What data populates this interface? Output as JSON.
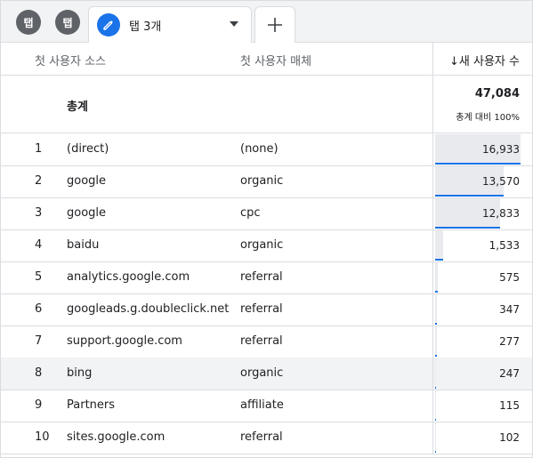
{
  "tabs": {
    "tab1_label": "탭",
    "tab2_label": "탭",
    "active_label": "탭 3개",
    "add_icon": "plus-icon",
    "edit_icon": "pencil-icon",
    "menu_icon": "caret-down-icon"
  },
  "table": {
    "headers": {
      "source": "첫 사용자 소스",
      "medium": "첫 사용자 매체",
      "metric": "↓새 사용자 수"
    },
    "totals": {
      "label": "총계",
      "value": "47,084",
      "sub": "총계 대비 100%"
    },
    "max_value": 16933,
    "rows": [
      {
        "rank": "1",
        "source": "(direct)",
        "medium": "(none)",
        "value": "16,933",
        "num": 16933
      },
      {
        "rank": "2",
        "source": "google",
        "medium": "organic",
        "value": "13,570",
        "num": 13570
      },
      {
        "rank": "3",
        "source": "google",
        "medium": "cpc",
        "value": "12,833",
        "num": 12833
      },
      {
        "rank": "4",
        "source": "baidu",
        "medium": "organic",
        "value": "1,533",
        "num": 1533
      },
      {
        "rank": "5",
        "source": "analytics.google.com",
        "medium": "referral",
        "value": "575",
        "num": 575
      },
      {
        "rank": "6",
        "source": "googleads.g.doubleclick.net",
        "medium": "referral",
        "value": "347",
        "num": 347
      },
      {
        "rank": "7",
        "source": "support.google.com",
        "medium": "referral",
        "value": "277",
        "num": 277
      },
      {
        "rank": "8",
        "source": "bing",
        "medium": "organic",
        "value": "247",
        "num": 247
      },
      {
        "rank": "9",
        "source": "Partners",
        "medium": "affiliate",
        "value": "115",
        "num": 115
      },
      {
        "rank": "10",
        "source": "sites.google.com",
        "medium": "referral",
        "value": "102",
        "num": 102
      }
    ],
    "highlighted_rank": "8"
  },
  "colors": {
    "accent": "#1a73e8",
    "bar_fill": "#e8eaed",
    "row_highlight": "#f1f3f4"
  }
}
